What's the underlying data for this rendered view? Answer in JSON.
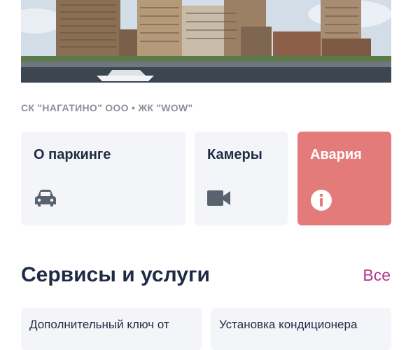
{
  "hero": {
    "image": "residential-complex-riverfront-photo"
  },
  "header": {
    "subtitle": "СК \"НАГАТИНО\" ООО • ЖК \"WOW\""
  },
  "quick_actions": [
    {
      "label": "О паркинге",
      "icon": "car-icon"
    },
    {
      "label": "Камеры",
      "icon": "video-camera-icon"
    },
    {
      "label": "Авария",
      "icon": "info-icon"
    }
  ],
  "colors": {
    "accident": "#e47b7b",
    "accent": "#b3348b",
    "text": "#1f2a44",
    "card": "#f3f5f8"
  },
  "services": {
    "title": "Сервисы и услуги",
    "all_label": "Все",
    "items": [
      {
        "label": "Дополнительный ключ от"
      },
      {
        "label": "Установка кондиционера"
      }
    ]
  }
}
